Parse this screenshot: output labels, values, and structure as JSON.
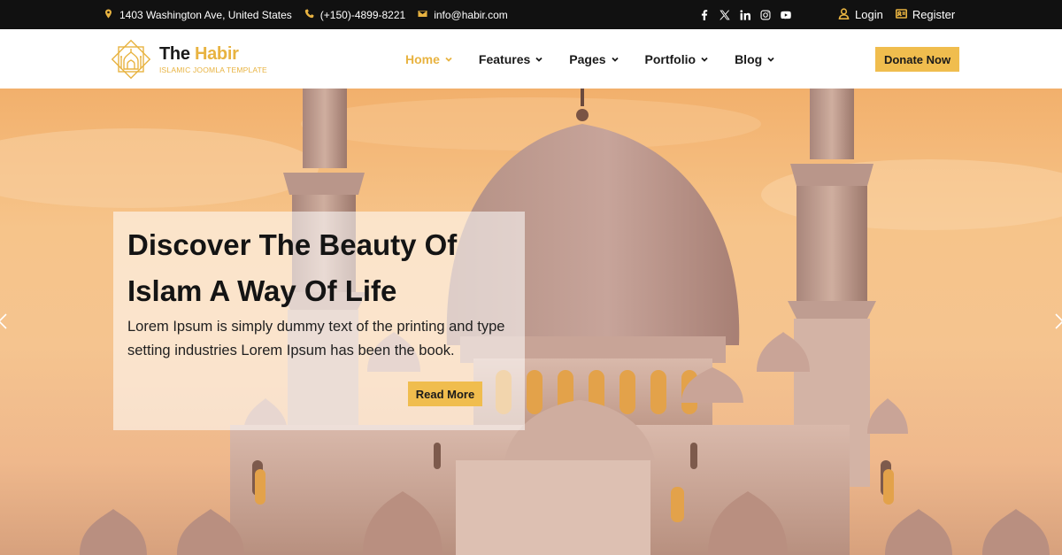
{
  "topbar": {
    "address": "1403 Washington Ave, United States",
    "phone": "(+150)-4899-8221",
    "email": "info@habir.com",
    "social": [
      "facebook-icon",
      "x-icon",
      "linkedin-icon",
      "instagram-icon",
      "youtube-icon"
    ],
    "login": "Login",
    "register": "Register"
  },
  "brand": {
    "name_part1": "The",
    "name_part2": "Habir",
    "tagline": "ISLAMIC JOOMLA TEMPLATE"
  },
  "nav": {
    "items": [
      {
        "label": "Home",
        "active": true
      },
      {
        "label": "Features",
        "active": false
      },
      {
        "label": "Pages",
        "active": false
      },
      {
        "label": "Portfolio",
        "active": false
      },
      {
        "label": "Blog",
        "active": false
      }
    ],
    "donate_label": "Donate Now"
  },
  "hero": {
    "title": "Discover The Beauty Of Islam A Way Of Life",
    "text": "Lorem Ipsum is simply dummy text of the printing and type setting industries Lorem Ipsum has been the book.",
    "button_label": "Read More"
  },
  "colors": {
    "accent": "#e8b341",
    "button": "#f0bd4e",
    "topbar_bg": "#111111"
  }
}
